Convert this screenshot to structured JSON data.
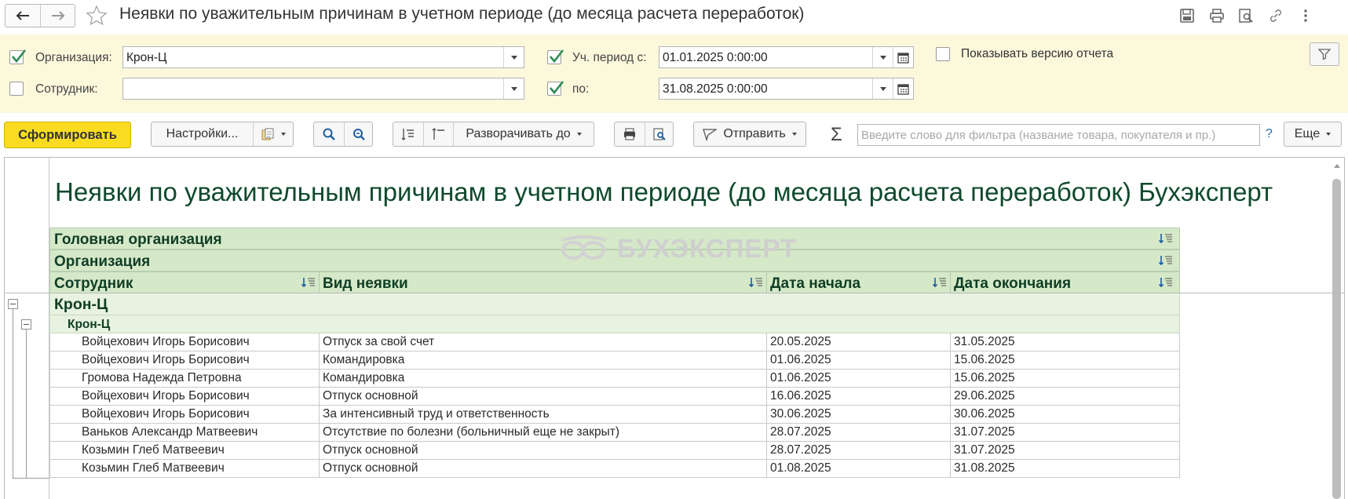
{
  "window": {
    "title": "Неявки по уважительным причинам в учетном периоде (до месяца расчета переработок)"
  },
  "filters": {
    "organization": {
      "checked": true,
      "label": "Организация:",
      "value": "Крон-Ц"
    },
    "employee": {
      "checked": false,
      "label": "Сотрудник:",
      "value": ""
    },
    "period_from": {
      "checked": true,
      "label": "Уч. период с:",
      "value": "01.01.2025  0:00:00"
    },
    "period_to": {
      "checked": true,
      "label": "по:",
      "value": "31.08.2025  0:00:00"
    },
    "show_version": {
      "checked": false,
      "label": "Показывать версию отчета"
    }
  },
  "toolbar": {
    "generate_label": "Сформировать",
    "settings_label": "Настройки...",
    "expand_label": "Разворачивать до",
    "send_label": "Отправить",
    "sigma": "Σ",
    "search_placeholder": "Введите слово для фильтра (название товара, покупателя и пр.)",
    "help": "?",
    "more_label": "Еще"
  },
  "report": {
    "title": "Неявки по уважительным причинам в учетном периоде (до месяца расчета переработок) Бухэксперт",
    "watermark": "БУХЭКСПЕРТ",
    "header_rows": [
      "Головная организация",
      "Организация"
    ],
    "columns": [
      "Сотрудник",
      "Вид неявки",
      "Дата начала",
      "Дата окончания"
    ],
    "group_head_org": "Крон-Ц",
    "group_org": "Крон-Ц",
    "rows": [
      [
        "Войцехович Игорь Борисович",
        "Отпуск за свой счет",
        "20.05.2025",
        "31.05.2025"
      ],
      [
        "Войцехович Игорь Борисович",
        "Командировка",
        "01.06.2025",
        "15.06.2025"
      ],
      [
        "Громова Надежда Петровна",
        "Командировка",
        "01.06.2025",
        "15.06.2025"
      ],
      [
        "Войцехович Игорь Борисович",
        "Отпуск основной",
        "16.06.2025",
        "29.06.2025"
      ],
      [
        "Войцехович Игорь Борисович",
        "За интенсивный труд и ответственность",
        "30.06.2025",
        "30.06.2025"
      ],
      [
        "Ваньков Александр Матвеевич",
        "Отсутствие по болезни (больничный еще не закрыт)",
        "28.07.2025",
        "31.07.2025"
      ],
      [
        "Козьмин Глеб Матвеевич",
        "Отпуск основной",
        "28.07.2025",
        "31.07.2025"
      ],
      [
        "Козьмин Глеб Матвеевич",
        "Отпуск основной",
        "01.08.2025",
        "31.08.2025"
      ]
    ]
  },
  "colors": {
    "accent_yellow": "#f9dc21",
    "panel_bg": "#fbf8dc",
    "header_green": "#d5e8c8",
    "title_green": "#0f4a2d",
    "check_green": "#2e8b57"
  }
}
